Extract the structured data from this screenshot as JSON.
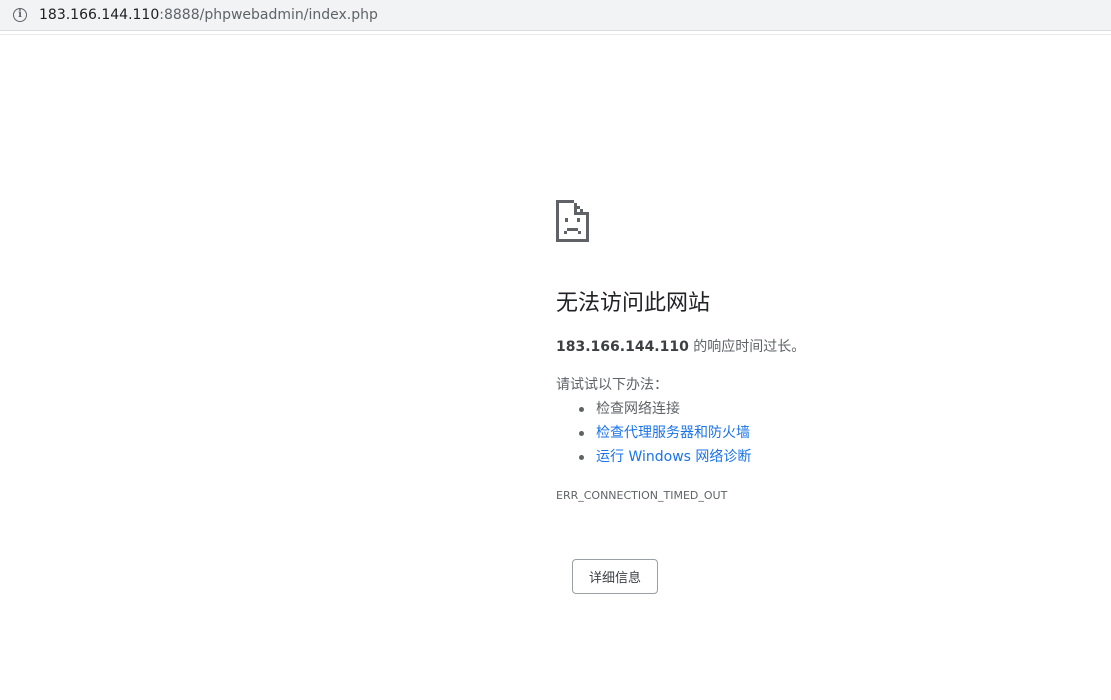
{
  "address_bar": {
    "host": "183.166.144.110",
    "rest": ":8888/phpwebadmin/index.php",
    "info_icon": "info-icon"
  },
  "error": {
    "icon": "sad-page-icon",
    "title": "无法访问此网站",
    "summary_host": "183.166.144.110",
    "summary_text": " 的响应时间过长。",
    "try_label": "请试试以下办法：",
    "suggestions": [
      {
        "text": "检查网络连接",
        "is_link": false
      },
      {
        "text": "检查代理服务器和防火墙",
        "is_link": true
      },
      {
        "text": "运行 Windows 网络诊断",
        "is_link": true
      }
    ],
    "code": "ERR_CONNECTION_TIMED_OUT",
    "details_button": "详细信息"
  },
  "colors": {
    "link": "#1a73e8",
    "text": "#5f6368",
    "title": "#202124"
  }
}
